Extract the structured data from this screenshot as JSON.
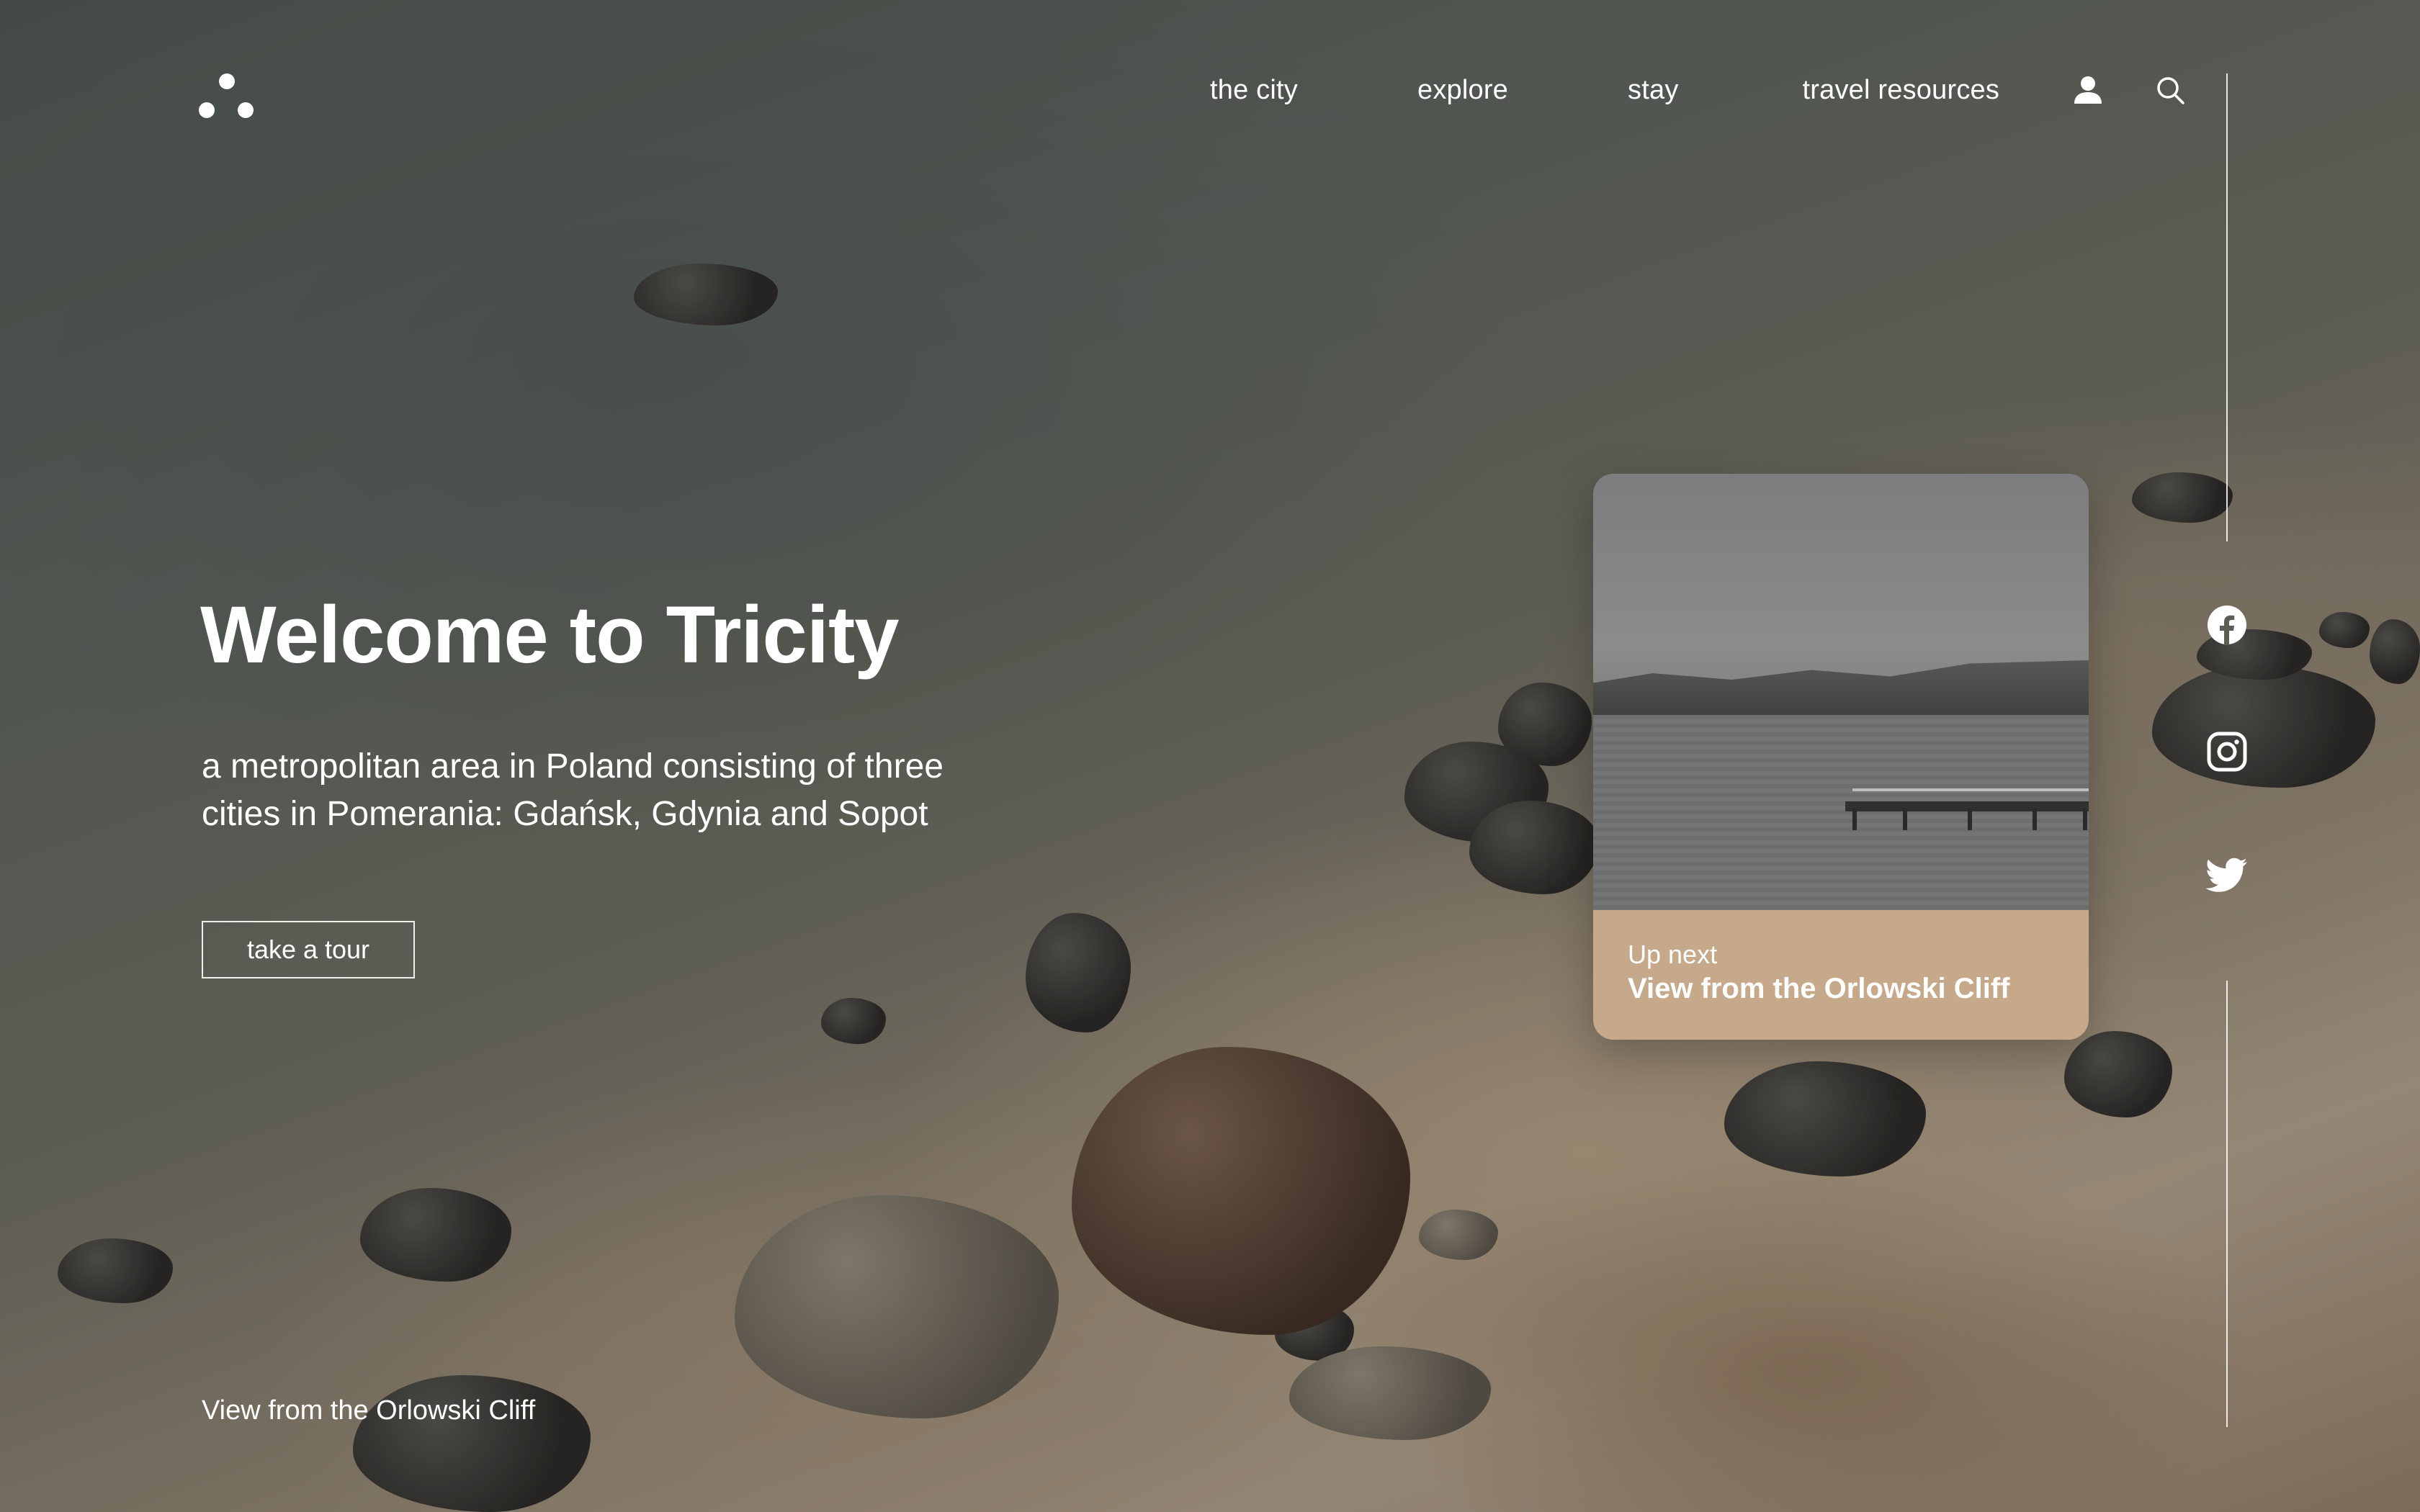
{
  "nav": {
    "items": [
      "the city",
      "explore",
      "stay",
      "travel resources"
    ],
    "user_icon": "user-icon",
    "search_icon": "search-icon"
  },
  "hero": {
    "title": "Welcome to Tricity",
    "subtitle": "a metropolitan area in Poland consisting of three cities in Pomerania: Gdańsk, Gdynia and Sopot",
    "cta_label": "take a tour",
    "photo_caption": "View from the Orlowski Cliff"
  },
  "up_next": {
    "label": "Up next",
    "title": "View from the Orlowski Cliff"
  },
  "social": [
    "facebook-icon",
    "instagram-icon",
    "twitter-icon"
  ],
  "colors": {
    "text": "#ffffff",
    "card_footer": "#c6a98a"
  }
}
